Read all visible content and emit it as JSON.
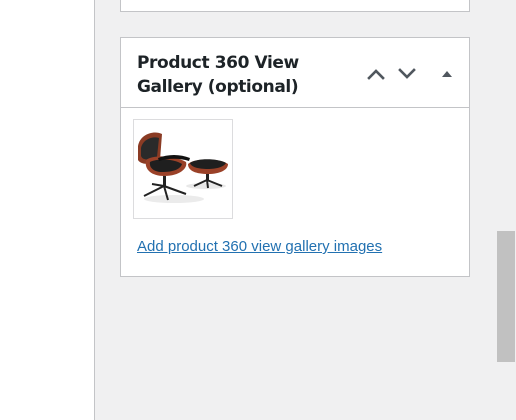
{
  "panel": {
    "title": "Product 360 View Gallery (optional)",
    "controls": {
      "move_up_icon": "chevron-up-icon",
      "move_down_icon": "chevron-down-icon",
      "toggle_icon": "triangle-up-icon"
    },
    "gallery": {
      "images": [
        {
          "alt": "Lounge chair with ottoman"
        }
      ]
    },
    "add_link_label": "Add product 360 view gallery images"
  },
  "colors": {
    "link": "#2271b1",
    "border": "#c3c4c7",
    "background": "#f0f0f1",
    "icon": "#50575e"
  }
}
